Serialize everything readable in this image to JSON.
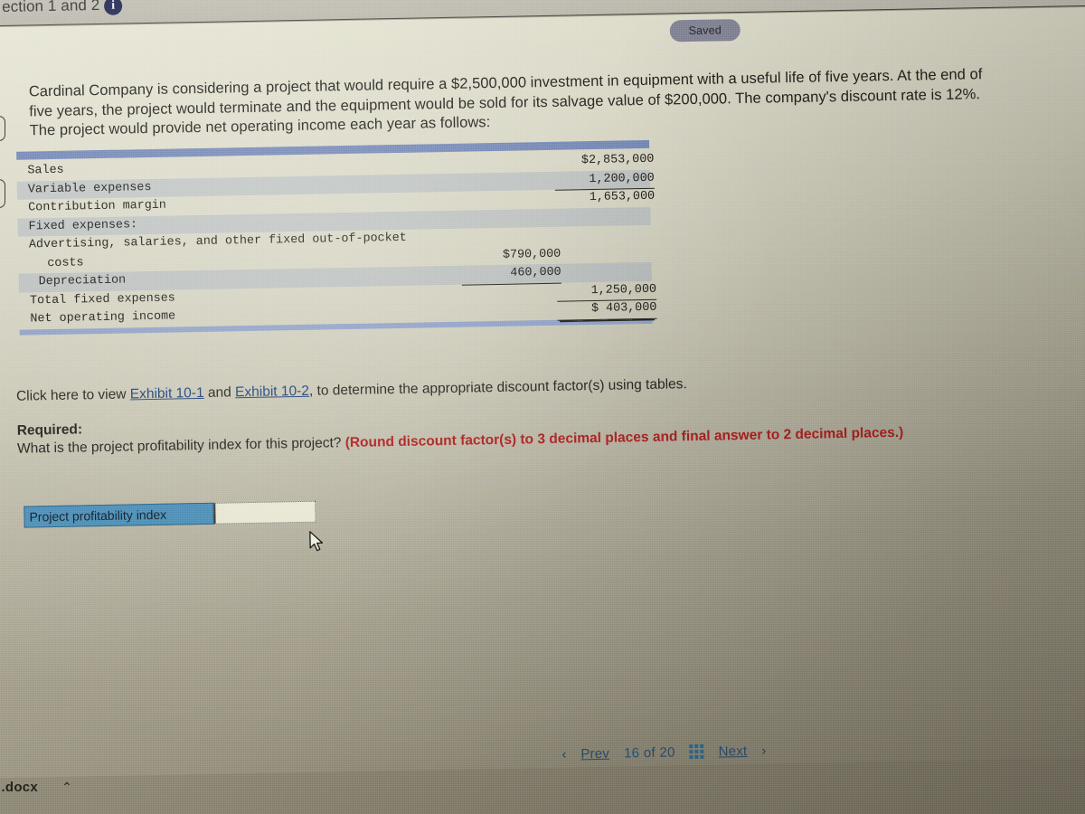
{
  "window": {
    "tab_title": "ection 1 and 2",
    "info_icon": "info-icon",
    "saved_badge": "Saved"
  },
  "question": {
    "body": "Cardinal Company is considering a project that would require a $2,500,000 investment in equipment with a useful life of five years. At the end of five years, the project would terminate and the equipment would be sold for its salvage value of $200,000. The company's discount rate is 12%. The project would provide net operating income each year as follows:"
  },
  "fin_table": {
    "rows": [
      {
        "label": "Sales",
        "indent": 0,
        "stripe": false,
        "c1": "",
        "c2": "$2,853,000",
        "c1_rule": "",
        "c2_rule": ""
      },
      {
        "label": "Variable expenses",
        "indent": 0,
        "stripe": true,
        "c1": "",
        "c2": "1,200,000",
        "c1_rule": "",
        "c2_rule": "ul1"
      },
      {
        "label": "Contribution margin",
        "indent": 0,
        "stripe": false,
        "c1": "",
        "c2": "1,653,000",
        "c1_rule": "",
        "c2_rule": ""
      },
      {
        "label": "Fixed expenses:",
        "indent": 0,
        "stripe": true,
        "c1": "",
        "c2": "",
        "c1_rule": "",
        "c2_rule": ""
      },
      {
        "label": "Advertising, salaries, and other fixed out-of-pocket",
        "indent": 0,
        "stripe": false,
        "c1": "",
        "c2": "",
        "c1_rule": "",
        "c2_rule": ""
      },
      {
        "label": "costs",
        "indent": 2,
        "stripe": false,
        "c1": "$790,000",
        "c2": "",
        "c1_rule": "",
        "c2_rule": ""
      },
      {
        "label": "Depreciation",
        "indent": 1,
        "stripe": true,
        "c1": "460,000",
        "c2": "",
        "c1_rule": "ul1",
        "c2_rule": ""
      },
      {
        "label": "Total fixed expenses",
        "indent": 0,
        "stripe": false,
        "c1": "",
        "c2": "1,250,000",
        "c1_rule": "",
        "c2_rule": "ul1"
      },
      {
        "label": "Net operating income",
        "indent": 0,
        "stripe": false,
        "c1": "",
        "c2": "$   403,000",
        "c1_rule": "",
        "c2_rule": "dbl"
      }
    ]
  },
  "exhibit_line": {
    "pre": "Click here to view ",
    "link1": "Exhibit 10-1",
    "mid": " and ",
    "link2": "Exhibit 10-2",
    "post": ", to determine the appropriate discount factor(s) using tables."
  },
  "required": {
    "heading": "Required:",
    "prompt": "What is the project profitability index for this project?",
    "note": "(Round discount factor(s) to 3 decimal places and final answer to 2 decimal places.)"
  },
  "answer": {
    "label": "Project profitability index",
    "value": "",
    "placeholder": ""
  },
  "pager": {
    "prev_chevron": "‹",
    "prev_label": "Prev",
    "current": "16",
    "of": "of",
    "total": "20",
    "grid_icon": "grid-icon",
    "next_label": "Next",
    "next_chevron": "›"
  },
  "taskbar": {
    "download_file": "....docx",
    "caret": "⌃"
  },
  "colors": {
    "table_header_bar": "#7286b5",
    "table_stripe": "#8296be",
    "answer_label_bg": "#4e90b8",
    "link": "#1a3f7a",
    "red_note": "#b02020",
    "pager_link": "#2b4f70",
    "saved_pill": "#7d7f93",
    "info_icon": "#141b4d"
  }
}
